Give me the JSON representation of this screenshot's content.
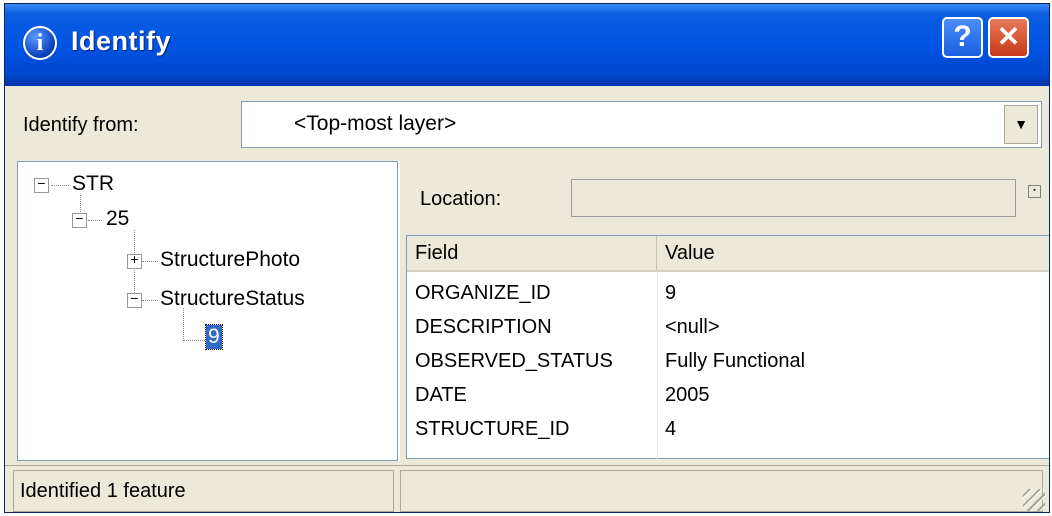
{
  "window": {
    "title": "Identify",
    "help_label": "?",
    "close_label": "✕"
  },
  "identify_from": {
    "label": "Identify from:",
    "value": "<Top-most layer>"
  },
  "tree": {
    "root": "STR",
    "child": "25",
    "items": [
      "StructurePhoto",
      "StructureStatus"
    ],
    "selected_leaf": "9"
  },
  "location": {
    "label": "Location:",
    "value": ""
  },
  "table": {
    "headers": [
      "Field",
      "Value"
    ],
    "rows": [
      [
        "ORGANIZE_ID",
        "9"
      ],
      [
        "DESCRIPTION",
        "<null>"
      ],
      [
        "OBSERVED_STATUS",
        "Fully Functional"
      ],
      [
        "DATE",
        "2005"
      ],
      [
        "STRUCTURE_ID",
        "4"
      ]
    ]
  },
  "status": {
    "text": "Identified 1 feature"
  },
  "icons": {
    "info": "info-icon",
    "help": "help-icon",
    "close": "close-icon",
    "dropdown": "chevron-down-icon",
    "collapse": "minus-expander-icon",
    "expand": "plus-expander-icon",
    "resize": "resize-grip-icon"
  },
  "colors": {
    "titlebar": "#0054e3",
    "selection": "#316ac5",
    "close_button": "#c73a18",
    "chrome": "#ece9d8"
  }
}
